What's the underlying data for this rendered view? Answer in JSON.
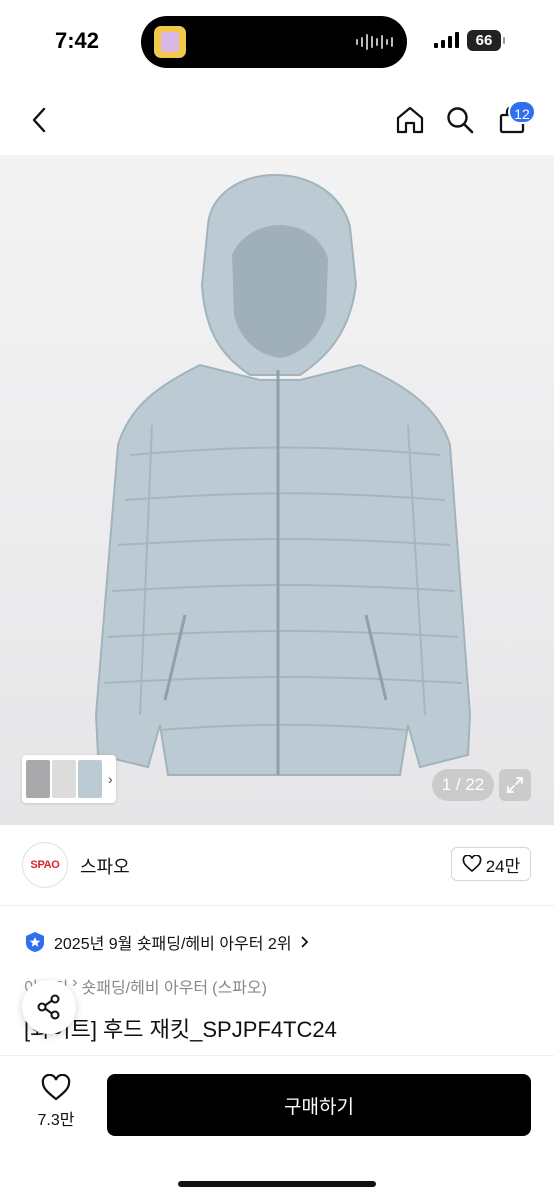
{
  "status_bar": {
    "time": "7:42",
    "battery": "66"
  },
  "header": {
    "back_icon": "chevron-left-icon",
    "home_icon": "home-icon",
    "search_icon": "search-icon",
    "cart_icon": "shopping-bag-icon",
    "cart_count": "12",
    "accent_color": "#2f6ff2"
  },
  "gallery": {
    "counter": "1 / 22",
    "thumb_arrow": "›",
    "jacket_color": "#bccbd3"
  },
  "brand": {
    "logo_text": "SPAO",
    "name": "스파오",
    "like_count": "24만"
  },
  "ranking": {
    "text": "2025년 9월 숏패딩/헤비 아우터 2위"
  },
  "breadcrumb": {
    "items": [
      "아우터",
      "숏패딩/헤비 아우터",
      "(스파오)"
    ]
  },
  "product": {
    "title": "[화이트] 후드 재킷_SPJPF4TC24"
  },
  "bottom_bar": {
    "wish_count": "7.3만",
    "buy_label": "구매하기"
  }
}
